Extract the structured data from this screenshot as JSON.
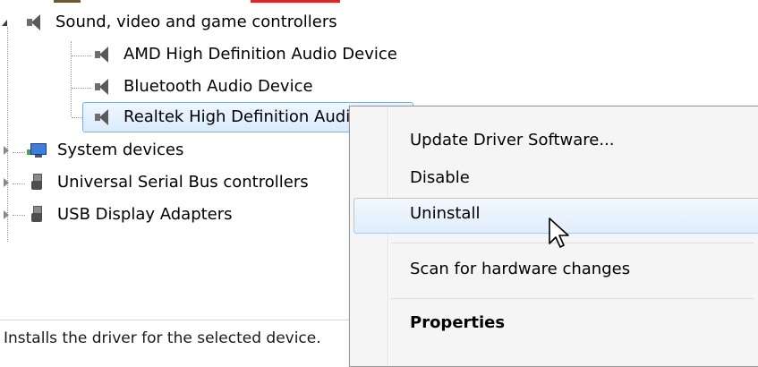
{
  "tree": {
    "category": "Sound, video and game controllers",
    "children": [
      "AMD High Definition Audio Device",
      "Bluetooth Audio Device",
      "Realtek High Definition Audio"
    ],
    "siblings": [
      "System devices",
      "Universal Serial Bus controllers",
      "USB Display Adapters"
    ]
  },
  "context_menu": {
    "items": [
      "Update Driver Software...",
      "Disable",
      "Uninstall",
      "Scan for hardware changes",
      "Properties"
    ],
    "hovered": "Uninstall"
  },
  "status_bar": {
    "text": "Installs the driver for the selected device."
  },
  "colors": {
    "selection_border": "#84acdd",
    "menu_background": "#f5f5f5",
    "hover_border": "#a9c9ec"
  }
}
